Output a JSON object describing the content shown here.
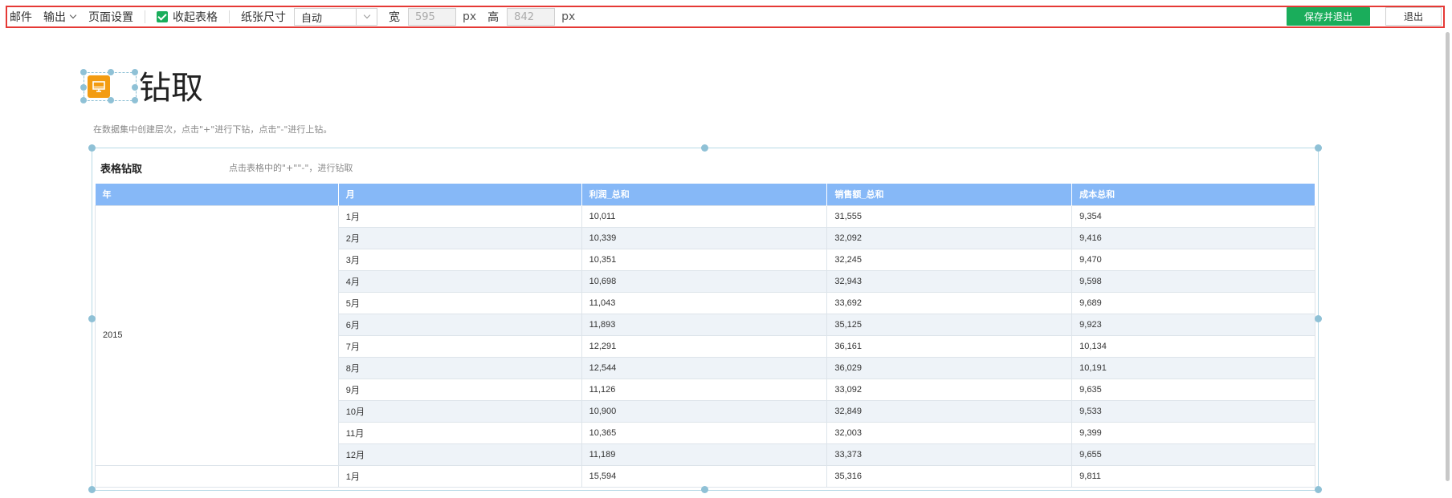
{
  "toolbar": {
    "mail": "邮件",
    "export": "输出",
    "page_setup": "页面设置",
    "collapse_table": "收起表格",
    "paper_size_label": "纸张尺寸",
    "paper_size_value": "自动",
    "width_label": "宽",
    "width_value": "595",
    "height_label": "高",
    "height_value": "842",
    "unit": "px",
    "save_exit": "保存并退出",
    "exit": "退出"
  },
  "page": {
    "title": "钻取",
    "description": "在数据集中创建层次，点击\"+\"进行下钻，点击\"-\"进行上钻。"
  },
  "table_widget": {
    "title": "表格钻取",
    "hint": "点击表格中的\"+\"\"-\"，进行钻取",
    "columns": [
      "年",
      "月",
      "利润_总和",
      "销售额_总和",
      "成本总和"
    ],
    "groups": [
      {
        "year": "2015",
        "rows": [
          [
            "1月",
            "10,011",
            "31,555",
            "9,354"
          ],
          [
            "2月",
            "10,339",
            "32,092",
            "9,416"
          ],
          [
            "3月",
            "10,351",
            "32,245",
            "9,470"
          ],
          [
            "4月",
            "10,698",
            "32,943",
            "9,598"
          ],
          [
            "5月",
            "11,043",
            "33,692",
            "9,689"
          ],
          [
            "6月",
            "11,893",
            "35,125",
            "9,923"
          ],
          [
            "7月",
            "12,291",
            "36,161",
            "10,134"
          ],
          [
            "8月",
            "12,544",
            "36,029",
            "10,191"
          ],
          [
            "9月",
            "11,126",
            "33,092",
            "9,635"
          ],
          [
            "10月",
            "10,900",
            "32,849",
            "9,533"
          ],
          [
            "11月",
            "10,365",
            "32,003",
            "9,399"
          ],
          [
            "12月",
            "11,189",
            "33,373",
            "9,655"
          ]
        ]
      },
      {
        "year": "",
        "rows": [
          [
            "1月",
            "15,594",
            "35,316",
            "9,811"
          ]
        ]
      }
    ]
  },
  "colors": {
    "accent_green": "#1aad5b",
    "header_blue": "#86b8f7",
    "icon_orange": "#f39c12",
    "selection_border": "#e53935"
  }
}
